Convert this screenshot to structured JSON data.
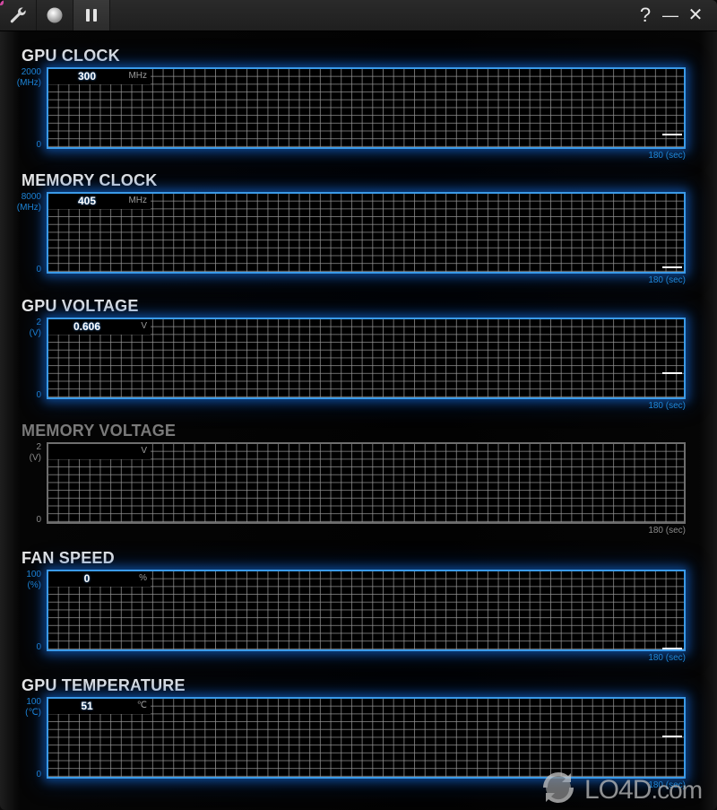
{
  "toolbar": {
    "buttons": [
      {
        "name": "settings",
        "icon": "wrench-icon"
      },
      {
        "name": "record",
        "icon": "record-circle-icon"
      },
      {
        "name": "pause",
        "icon": "pause-icon",
        "active": true
      }
    ],
    "window_controls": {
      "help": "?",
      "minimize": "—",
      "close": "✕"
    }
  },
  "accent_color": "#3a9ae8",
  "panels": [
    {
      "title": "GPU CLOCK",
      "max": "2000",
      "unit_axis": "(MHz)",
      "min": "0",
      "value": "300",
      "unit": "MHz",
      "value_fraction": 0.15,
      "time_label": "180 (sec)",
      "enabled": true
    },
    {
      "title": "MEMORY CLOCK",
      "max": "8000",
      "unit_axis": "(MHz)",
      "min": "0",
      "value": "405",
      "unit": "MHz",
      "value_fraction": 0.0506,
      "time_label": "180 (sec)",
      "enabled": true
    },
    {
      "title": "GPU VOLTAGE",
      "max": "2",
      "unit_axis": "(V)",
      "min": "0",
      "value": "0.606",
      "unit": "V",
      "value_fraction": 0.303,
      "time_label": "180 (sec)",
      "enabled": true
    },
    {
      "title": "MEMORY VOLTAGE",
      "max": "2",
      "unit_axis": "(V)",
      "min": "0",
      "value": "",
      "unit": "V",
      "value_fraction": null,
      "time_label": "180 (sec)",
      "enabled": false
    },
    {
      "title": "FAN SPEED",
      "max": "100",
      "unit_axis": "(%)",
      "min": "0",
      "value": "0",
      "unit": "%",
      "value_fraction": 0,
      "time_label": "180 (sec)",
      "enabled": true
    },
    {
      "title": "GPU TEMPERATURE",
      "max": "100",
      "unit_axis": "(℃)",
      "min": "0",
      "value": "51",
      "unit": "℃",
      "value_fraction": 0.51,
      "time_label": "180 (sec)",
      "enabled": true
    }
  ],
  "watermark": {
    "brand": "LO4D",
    "suffix": ".com"
  }
}
